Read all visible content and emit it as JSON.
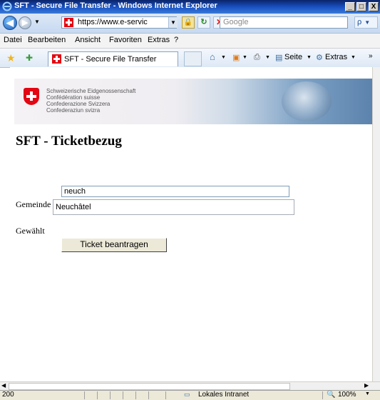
{
  "window": {
    "title": "SFT - Secure File Transfer - Windows Internet Explorer",
    "controls": [
      "_",
      "□",
      "X"
    ]
  },
  "address_bar": {
    "url": "https://www.e-servic",
    "search_placeholder": "Google",
    "search_button": "ρ"
  },
  "menu": {
    "items": [
      "Datei",
      "Bearbeiten",
      "Ansicht",
      "Favoriten",
      "Extras",
      "?"
    ]
  },
  "tab": {
    "label": "SFT - Secure File Transfer"
  },
  "command_bar": {
    "seite": "Seite",
    "extras": "Extras"
  },
  "banner": {
    "lines": [
      "Schweizerische Eidgenossenschaft",
      "Confédération suisse",
      "Confederazione Svizzera",
      "Confederaziun svizra"
    ]
  },
  "page": {
    "title": "SFT - Ticketbezug",
    "search_value": "neuch",
    "gemeinde_label": "Gemeinde",
    "selected_gemeinde": "Neuchâtel",
    "gewaehlt_label": "Gewählt",
    "ticket_button": "Ticket beantragen"
  },
  "status_bar": {
    "left": "200",
    "zone": "Lokales Intranet",
    "zoom": "100%"
  }
}
